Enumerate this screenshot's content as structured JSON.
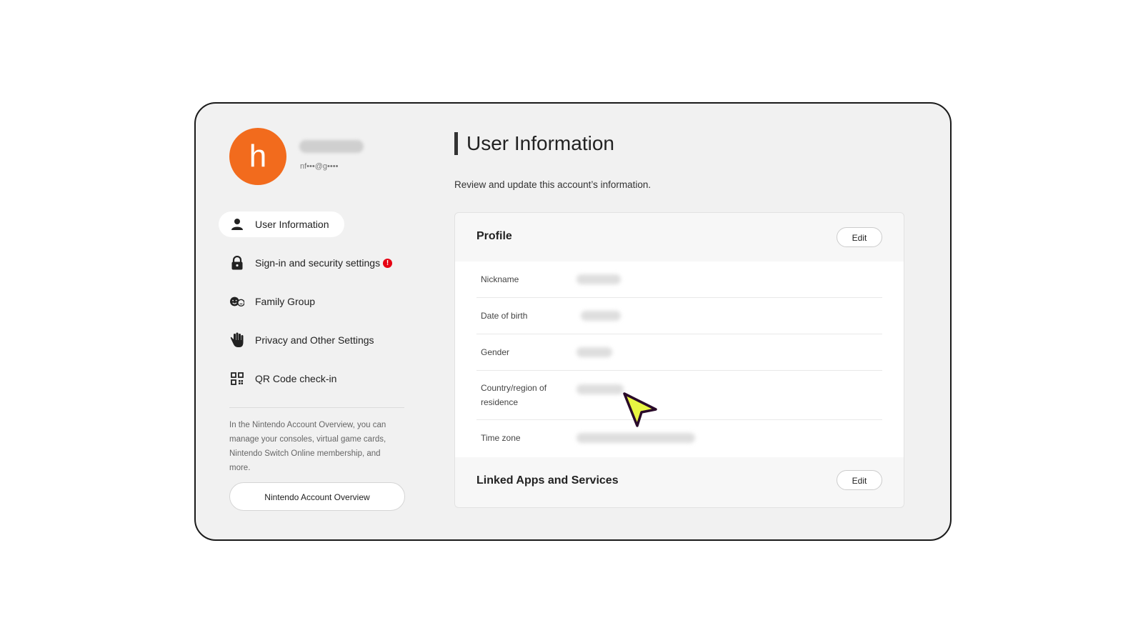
{
  "profile": {
    "avatar_letter": "h",
    "email": "nf•••@g••••"
  },
  "sidebar": {
    "items": [
      {
        "label": "User Information",
        "icon": "person-icon",
        "active": true
      },
      {
        "label": "Sign-in and security settings",
        "icon": "lock-icon",
        "alert": "!"
      },
      {
        "label": "Family Group",
        "icon": "family-icon"
      },
      {
        "label": "Privacy and Other Settings",
        "icon": "hand-icon"
      },
      {
        "label": "QR Code check-in",
        "icon": "qr-code-icon"
      }
    ],
    "overview_text": "In the Nintendo Account Overview, you can manage your consoles, virtual game cards, Nintendo Switch Online membership, and more.",
    "overview_button": "Nintendo Account Overview"
  },
  "main": {
    "title": "User Information",
    "description": "Review and update this account’s information.",
    "profile_card": {
      "title": "Profile",
      "edit_label": "Edit",
      "fields": [
        {
          "label": "Nickname"
        },
        {
          "label": "Date of birth"
        },
        {
          "label": "Gender"
        },
        {
          "label": "Country/region of residence"
        },
        {
          "label": "Time zone"
        }
      ]
    },
    "linked_card": {
      "title": "Linked Apps and Services",
      "edit_label": "Edit"
    }
  },
  "colors": {
    "avatar": "#f26b1d",
    "alert": "#e60012",
    "cursor": "#e8f542"
  }
}
